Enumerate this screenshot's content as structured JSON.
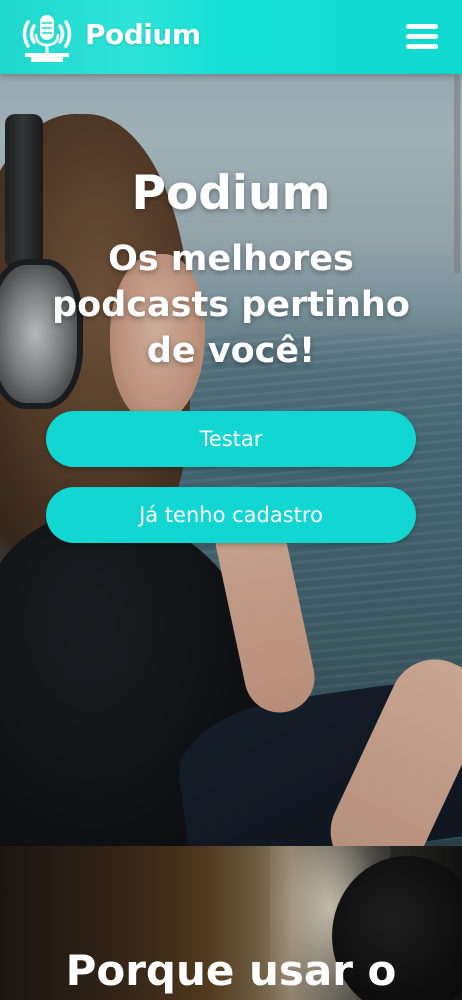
{
  "header": {
    "brand": "Podium",
    "logo_icon": "microphone-broadcast-icon",
    "menu_icon": "hamburger-menu-icon",
    "background": "#1fd6cd"
  },
  "hero": {
    "title": "Podium",
    "subtitle": "Os melhores podcasts pertinho de você!",
    "buttons": {
      "test_label": "Testar",
      "login_label": "Já tenho cadastro",
      "color": "#12d6d2"
    }
  },
  "section2": {
    "title": "Porque usar o"
  }
}
